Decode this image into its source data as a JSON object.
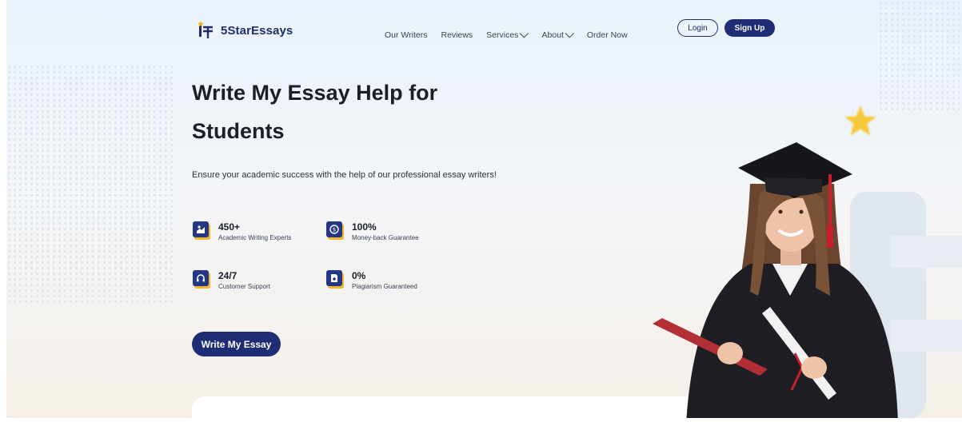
{
  "brand": {
    "name": "5StarEssays",
    "accent": "#1f2d75",
    "highlight": "#f4b62a"
  },
  "nav": {
    "items": [
      {
        "label": "Our Writers",
        "dropdown": false
      },
      {
        "label": "Reviews",
        "dropdown": false
      },
      {
        "label": "Services",
        "dropdown": true
      },
      {
        "label": "About",
        "dropdown": true
      },
      {
        "label": "Order Now",
        "dropdown": false
      }
    ],
    "login_label": "Login",
    "signup_label": "Sign Up"
  },
  "hero": {
    "title": "Write My Essay Help for Students",
    "subtitle": "Ensure your academic success with the help of our professional essay writers!",
    "features": [
      {
        "value": "450+",
        "label": "Academic Writing Experts",
        "icon": "writer-icon"
      },
      {
        "value": "100%",
        "label": "Money-back Guarantee",
        "icon": "money-icon"
      },
      {
        "value": "24/7",
        "label": "Customer Support",
        "icon": "headset-icon"
      },
      {
        "value": "0%",
        "label": "Plagiarism Guaranteed",
        "icon": "document-icon"
      }
    ],
    "cta_label": "Write My Essay"
  }
}
